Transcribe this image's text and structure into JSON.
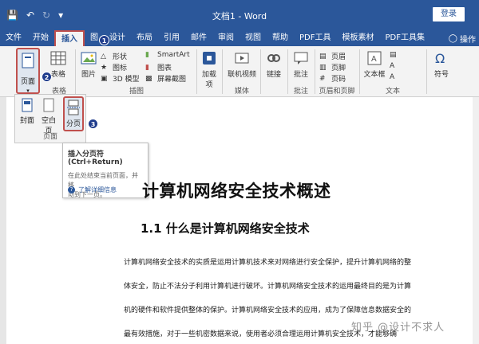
{
  "titlebar": {
    "doc_title": "文档1 - Word",
    "login_label": "登录"
  },
  "tabs": [
    "文件",
    "开始",
    "插入",
    "图",
    "设计",
    "布局",
    "引用",
    "邮件",
    "审阅",
    "视图",
    "帮助",
    "PDF工具",
    "模板素材",
    "PDF工具集"
  ],
  "active_tab_index": 2,
  "tell_me": "操作",
  "ribbon": {
    "page_button": "页面",
    "table_button": "表格",
    "picture_button": "图片",
    "shapes": "形状",
    "icons": "图标",
    "model3d": "3D 模型",
    "smartart": "SmartArt",
    "chart": "图表",
    "screenshot": "屏幕截图",
    "addins": "加载项",
    "online_video": "联机视频",
    "link": "链接",
    "comment": "批注",
    "header": "页眉",
    "footer": "页脚",
    "pagenum": "页码",
    "textbox": "文本框",
    "symbol": "符号",
    "groups": {
      "table": "表格",
      "illustrations": "插图",
      "media": "媒体",
      "comment": "批注",
      "header_footer": "页眉和页脚",
      "text": "文本"
    }
  },
  "page_panel": {
    "cover": "封面",
    "blank": "空白页",
    "break": "分页",
    "group_label": "页面"
  },
  "tooltip": {
    "title": "插入分页符 (Ctrl+Return)",
    "desc_line1": "在此处结束当前页面，并移",
    "desc_line2": "动到下一页。",
    "link": "了解详细信息"
  },
  "steps": [
    "1",
    "2",
    "3"
  ],
  "document": {
    "h1": "计算机网络安全技术概述",
    "h2": "1.1 什么是计算机网络安全技术",
    "p1": "计算机网络安全技术的实质是运用计算机技术来对网络进行安全保护，提升计算机网络的整",
    "p2": "体安全，防止不法分子利用计算机进行破坏。计算机网络安全技术的运用最终目的是为计算",
    "p3": "机的硬件和软件提供整体的保护。计算机网络安全技术的应用，成为了保障信息数据安全的",
    "p4": "最有效措施，对于一些机密数据来说，使用者必须合理运用计算机安全技术，才能够确"
  },
  "watermark": "知乎 @设计不求人",
  "colors": {
    "accent": "#2b579a",
    "highlight": "#c0504d",
    "step_marker": "#1f3c8c"
  }
}
